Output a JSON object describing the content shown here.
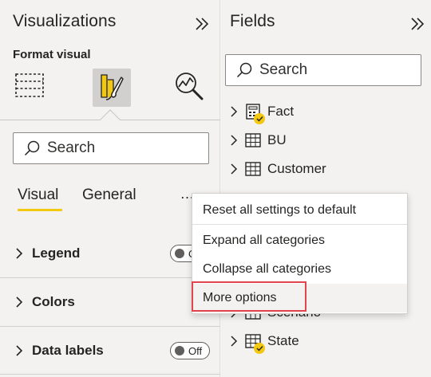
{
  "visualizations": {
    "title": "Visualizations",
    "collapse_icon": "double-chevron-right-icon",
    "format_label": "Format visual",
    "search_placeholder": "Search",
    "tabs": [
      {
        "label": "Visual",
        "active": true
      },
      {
        "label": "General",
        "active": false
      }
    ],
    "more_icon": "…",
    "sections": [
      {
        "label": "Legend",
        "toggle": "Off"
      },
      {
        "label": "Colors"
      },
      {
        "label": "Data labels",
        "toggle": "Off"
      }
    ]
  },
  "fields": {
    "title": "Fields",
    "collapse_icon": "double-chevron-right-icon",
    "search_placeholder": "Search",
    "tables": [
      {
        "name": "Fact",
        "icon": "calculator-table-icon",
        "checked": true
      },
      {
        "name": "BU",
        "icon": "table-icon",
        "checked": false
      },
      {
        "name": "Customer",
        "icon": "table-icon",
        "checked": false
      },
      {
        "name": "Scenario",
        "icon": "table-icon",
        "checked": false
      },
      {
        "name": "State",
        "icon": "table-icon",
        "checked": true
      }
    ]
  },
  "context_menu": {
    "items": [
      "Reset all settings to default",
      "Expand all categories",
      "Collapse all categories",
      "More options"
    ],
    "highlighted": "More options"
  },
  "colors": {
    "accent_yellow": "#f2c811",
    "highlight_red": "#e3434c",
    "pane_bg": "#f3f2f1"
  }
}
